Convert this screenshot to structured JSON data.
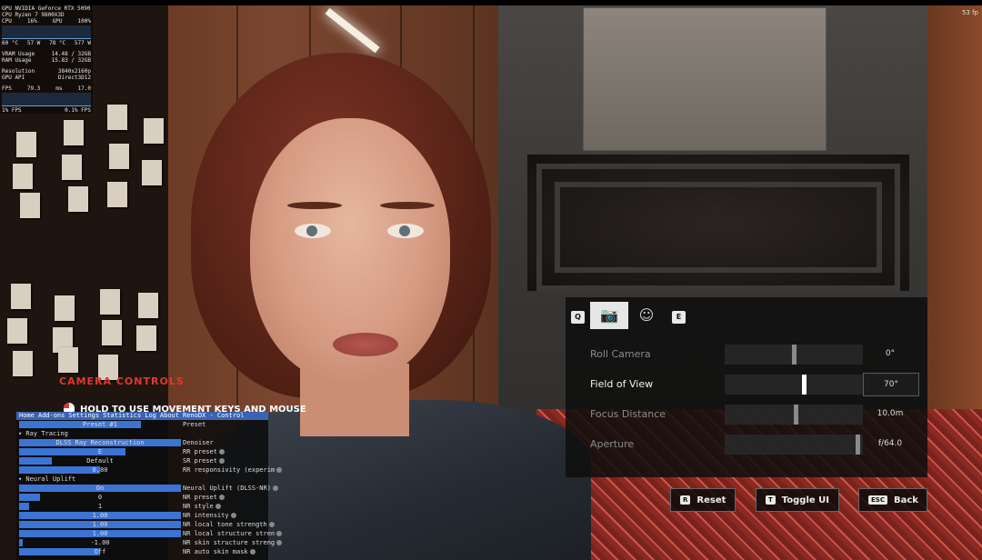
{
  "perf_overlay": {
    "gpu_name": "GPU NVIDIA GeForce RTX 5090",
    "cpu_name": "CPU Ryzen 7 9800X3D",
    "cpu_label": "CPU",
    "cpu_pct": "16%",
    "gpu_label": "GPU",
    "gpu_pct": "100%",
    "cpu_temp": "60 °C",
    "cpu_power": "57 W",
    "gpu_temp": "78 °C",
    "gpu_power": "577 W",
    "vram_label": "VRAM Usage",
    "vram_value": "14.48 / 32GB",
    "ram_label": "RAM Usage",
    "ram_value": "15.83 / 32GB",
    "res_label": "Resolution",
    "res_value": "3840x2160p",
    "api_label": "GPU API",
    "api_value": "Direct3D12",
    "fps_label": "FPS",
    "fps_value": "79.3",
    "ms_label": "ms",
    "ms_value": "17.0",
    "low1_label": "1% FPS",
    "low01_label": "0.1% FPS"
  },
  "corner_fps": "53 fp",
  "camera_controls": {
    "title": "CAMERA CONTROLS",
    "hold_text": "HOLD TO USE MOVEMENT KEYS AND MOUSE"
  },
  "addon_panel": {
    "tabs": [
      "Home",
      "Add-ons",
      "Settings",
      "Statistics",
      "Log",
      "About",
      "RenoDX - Control"
    ],
    "rows": [
      {
        "bar": "Preset #1",
        "label": "Preset",
        "fill": 0.75
      },
      {
        "section": "▾ Ray Tracing"
      },
      {
        "bar": "DLSS Ray Reconstruction",
        "label": "Denoiser",
        "fill": 1.0
      },
      {
        "bar": "E",
        "label": "RR preset",
        "fill": 0.66
      },
      {
        "bar": "Default",
        "label": "SR preset",
        "fill": 0.2
      },
      {
        "bar": "0.80",
        "label": "RR responsivity (experim",
        "fill": 0.5
      },
      {
        "section": "▾ Neural Uplift"
      },
      {
        "bar": "On",
        "label": "Neural Uplift (DLSS-NR)",
        "fill": 1.0
      },
      {
        "bar": "0",
        "label": "NR preset",
        "fill": 0.13
      },
      {
        "bar": "1",
        "label": "NR style",
        "fill": 0.06
      },
      {
        "bar": "1.00",
        "label": "NR intensity",
        "fill": 1.0
      },
      {
        "bar": "1.00",
        "label": "NR local tone strength",
        "fill": 1.0
      },
      {
        "bar": "1.00",
        "label": "NR local structure stren",
        "fill": 1.0
      },
      {
        "bar": "-1.00",
        "label": "NR skin structure streng",
        "fill": 0.02
      },
      {
        "bar": "Off",
        "label": "NR auto skin mask",
        "fill": 0.5
      }
    ]
  },
  "photo_mode": {
    "key_prev": "Q",
    "key_next": "E",
    "tabs": [
      {
        "icon": "camera-icon",
        "glyph": "📷",
        "active": true
      },
      {
        "icon": "face-filter-icon",
        "glyph": "☺",
        "active": false
      }
    ],
    "sliders": [
      {
        "label": "Roll Camera",
        "value": "0°",
        "level": 0.5,
        "focused": false
      },
      {
        "label": "Field of View",
        "value": "70°",
        "level": 0.58,
        "focused": true
      },
      {
        "label": "Focus Distance",
        "value": "10.0m",
        "level": 0.52,
        "focused": false
      },
      {
        "label": "Aperture",
        "value": "f/64.0",
        "level": 0.98,
        "focused": false
      }
    ],
    "buttons": [
      {
        "key": "R",
        "label": "Reset"
      },
      {
        "key": "T",
        "label": "Toggle UI"
      },
      {
        "key": "ESC",
        "label": "Back"
      }
    ]
  }
}
